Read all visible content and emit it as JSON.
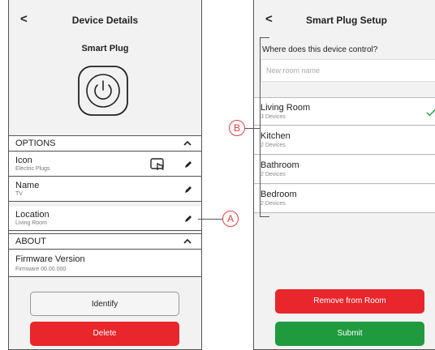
{
  "device_details": {
    "back_glyph": "<",
    "title": "Device Details",
    "device_name": "Smart Plug",
    "options_label": "OPTIONS",
    "items": [
      {
        "title": "Icon",
        "sub": "Electric Plugs"
      },
      {
        "title": "Name",
        "sub": "TV"
      },
      {
        "title": "Location",
        "sub": "Living Room"
      }
    ],
    "about_label": "ABOUT",
    "firmware": {
      "title": "Firmware Version",
      "sub": "Firmware 00.00.000"
    },
    "identify_label": "Identify",
    "delete_label": "Delete"
  },
  "smart_plug_setup": {
    "back_glyph": "<",
    "title": "Smart Plug Setup",
    "question": "Where does this device control?",
    "room_name_placeholder": "New room name",
    "rooms": [
      {
        "name": "Living Room",
        "count": "3 Devices",
        "selected": true
      },
      {
        "name": "Kitchen",
        "count": "2 Devices",
        "selected": false
      },
      {
        "name": "Bathroom",
        "count": "2 Devices",
        "selected": false
      },
      {
        "name": "Bedroom",
        "count": "2 Devices",
        "selected": false
      }
    ],
    "remove_label": "Remove from Room",
    "submit_label": "Submit"
  },
  "callouts": {
    "a": "A",
    "b": "B"
  },
  "colors": {
    "delete": "#e8262c",
    "submit": "#1f9a3e",
    "check": "#1f9a3e",
    "callout": "#d44444"
  }
}
